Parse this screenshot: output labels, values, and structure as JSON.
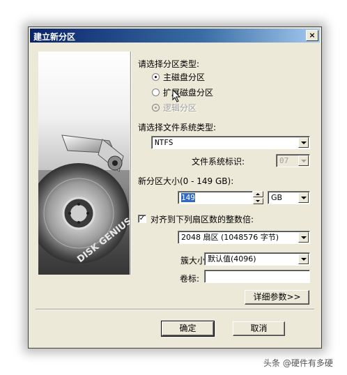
{
  "dialog": {
    "title": "建立新分区",
    "close_glyph": "×"
  },
  "banner": {
    "brand": "DISK GENIUS"
  },
  "partition_type": {
    "label": "请选择分区类型:",
    "options": [
      {
        "label": "主磁盘分区",
        "checked": true,
        "enabled": true
      },
      {
        "label": "扩展磁盘分区",
        "checked": false,
        "enabled": true
      },
      {
        "label": "逻辑分区",
        "checked": false,
        "enabled": false
      }
    ]
  },
  "fs_type": {
    "label": "请选择文件系统类型:",
    "value": "NTFS",
    "id_label": "文件系统标识:",
    "id_value": "07"
  },
  "size": {
    "label": "新分区大小(0 - 149 GB):",
    "value": "149",
    "unit": "GB"
  },
  "align": {
    "checked": true,
    "label": "对齐到下列扇区数的整数倍:",
    "value": "2048 扇区 (1048576 字节)"
  },
  "cluster": {
    "label": "簇大小:",
    "value": "默认值(4096)"
  },
  "volume": {
    "label": "卷标:",
    "value": ""
  },
  "buttons": {
    "details": "详细参数>>",
    "ok": "确定",
    "cancel": "取消"
  },
  "watermark": "头条 @硬件有多硬"
}
